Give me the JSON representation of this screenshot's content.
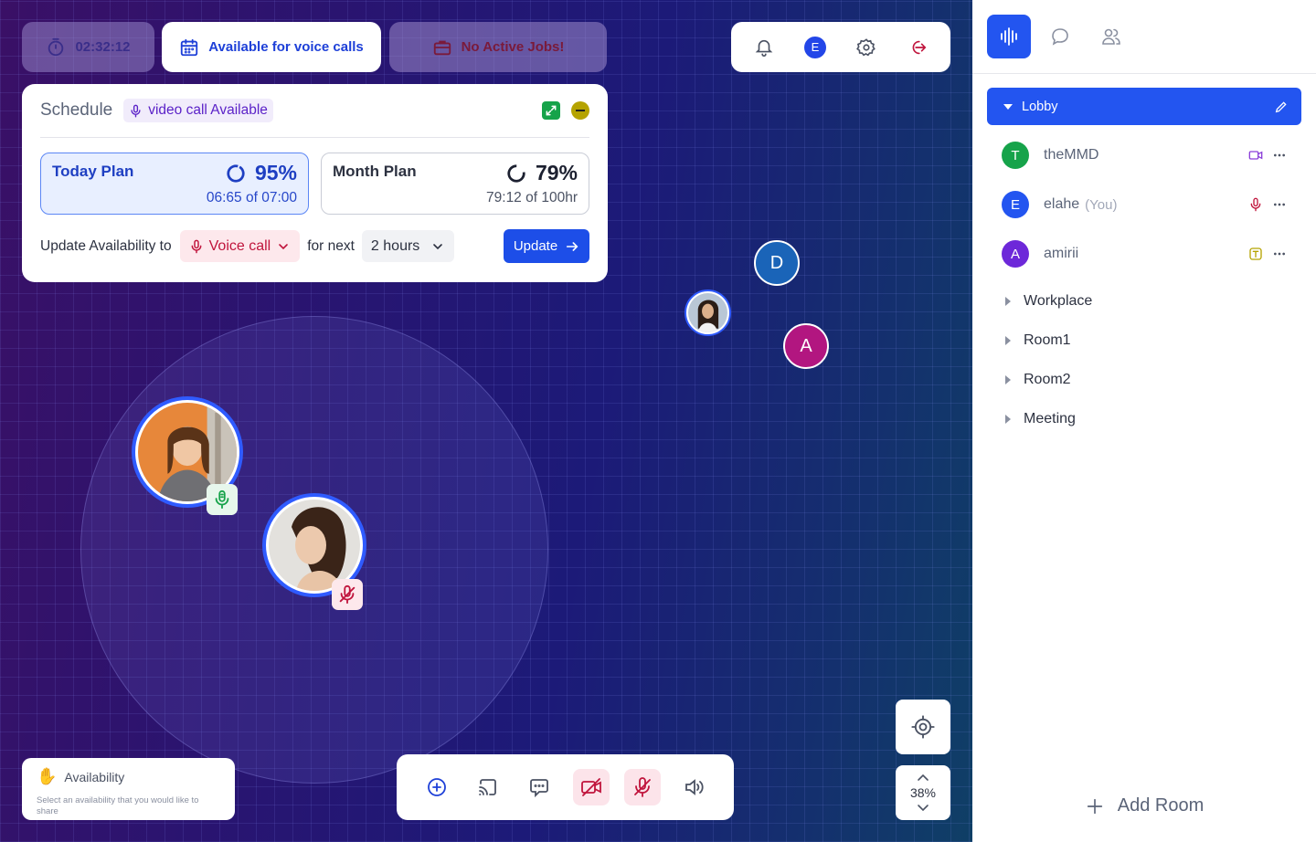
{
  "status": {
    "timer": "02:32:12",
    "availability": "Available for voice calls",
    "jobs": "No Active Jobs!"
  },
  "top_tools": {
    "user_initial": "E"
  },
  "schedule": {
    "title": "Schedule",
    "badge": "video call Available",
    "today": {
      "name": "Today Plan",
      "percent": "95%",
      "detail": "06:65 of 07:00"
    },
    "month": {
      "name": "Month Plan",
      "percent": "79%",
      "detail": "79:12 of 100hr"
    },
    "update_label": "Update Availability to",
    "mode": "Voice call",
    "for_next": "for next",
    "duration": "2 hours",
    "update_button": "Update"
  },
  "map": {
    "avatars": [
      {
        "initial": "D",
        "color": "#1a64b8"
      },
      {
        "initial": "A",
        "color": "#b21680"
      }
    ]
  },
  "availability_card": {
    "title": "Availability",
    "description": "Select an availability that you would like to share"
  },
  "zoom": {
    "level": "38%"
  },
  "sidebar": {
    "room": "Lobby",
    "members": [
      {
        "initial": "T",
        "name": "theMMD",
        "suffix": "",
        "color": "#16a34a"
      },
      {
        "initial": "E",
        "name": "elahe",
        "suffix": "(You)",
        "color": "#2355f0"
      },
      {
        "initial": "A",
        "name": "amirii",
        "suffix": "",
        "color": "#6d28d9"
      }
    ],
    "rooms": [
      "Workplace",
      "Room1",
      "Room2",
      "Meeting"
    ],
    "add_room": "Add Room"
  },
  "colors": {
    "accent": "#2355f0",
    "danger": "#c0143c",
    "success": "#16a34a"
  }
}
